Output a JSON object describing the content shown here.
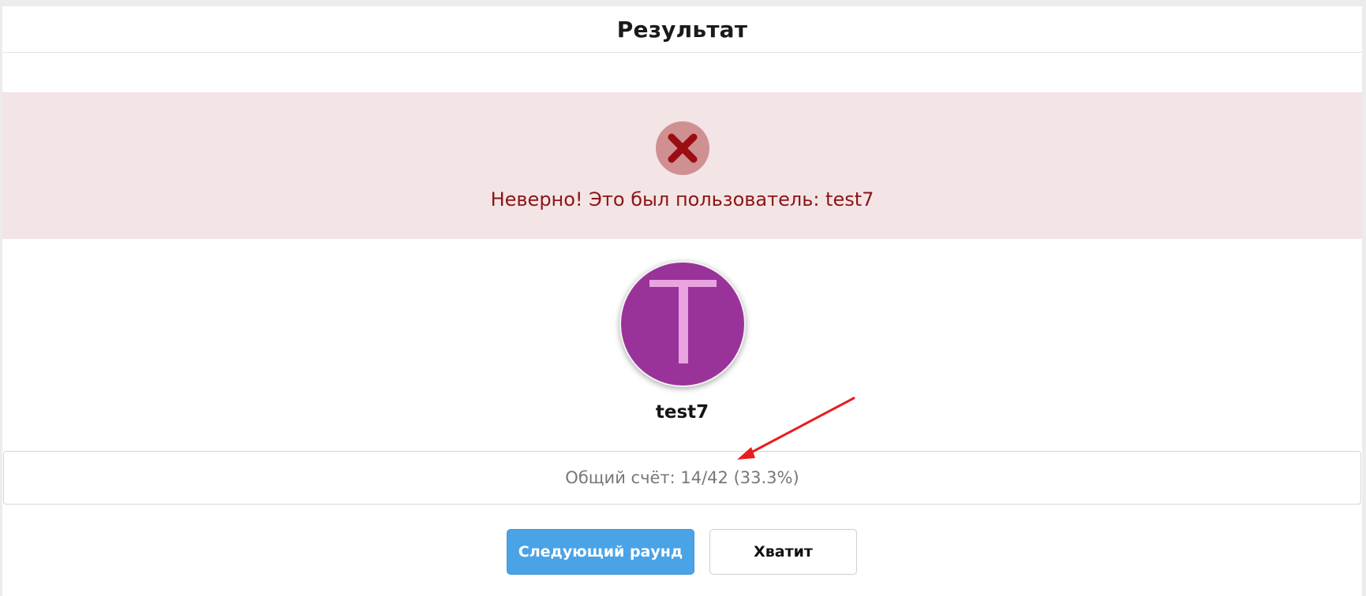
{
  "header": {
    "title": "Результат"
  },
  "result_alert": {
    "status": "incorrect",
    "icon": "cross-icon",
    "message": "Неверно! Это был пользователь: test7",
    "colors": {
      "background": "#f3e4e5",
      "icon_circle": "#d09091",
      "icon_cross": "#9b0d12",
      "text": "#8b1515"
    }
  },
  "user": {
    "avatar_letter": "T",
    "avatar_color": "#993399",
    "avatar_letter_color": "#e8a3e0",
    "name": "test7"
  },
  "score": {
    "text": "Общий счёт: 14/42 (33.3%)"
  },
  "actions": {
    "next_round_label": "Следующий раунд",
    "stop_label": "Хватит"
  },
  "annotation": {
    "color": "#e81c1c",
    "icon": "arrow-icon"
  }
}
